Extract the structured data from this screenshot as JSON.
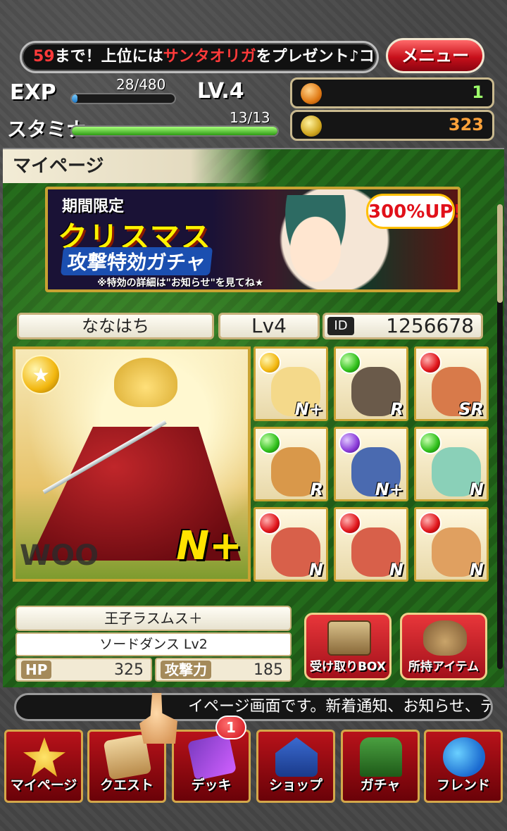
{
  "header": {
    "ticker_number": "59",
    "ticker_part1": "まで！上位には",
    "ticker_highlight": "サンタオリガ",
    "ticker_part2": "をプレゼント♪コ",
    "menu_label": "メニュー"
  },
  "stats": {
    "exp_label": "EXP",
    "exp_value": "28/480",
    "exp_fraction": 0.058,
    "level_label": "LV.4",
    "stamina_label": "スタミナ",
    "stamina_value": "13/13",
    "stamina_fraction": 1.0,
    "hearts": "1",
    "coins": "323"
  },
  "page": {
    "title": "マイページ"
  },
  "banner": {
    "line1": "期間限定",
    "line2": "クリスマス",
    "line3": "攻撃特効ガチャ",
    "note": "※特効の詳細は\"お知らせ\"を見てね★",
    "badge": "300%UP!"
  },
  "profile": {
    "name": "ななはち",
    "level": "Lv4",
    "id_label": "ID",
    "id_value": "1256678"
  },
  "leader": {
    "rank": "N+",
    "watermark": "WOO"
  },
  "deck": [
    {
      "orb": "yellow",
      "rank": "N+",
      "color": "#f4d98a"
    },
    {
      "orb": "green",
      "rank": "R",
      "color": "#6a5a4a"
    },
    {
      "orb": "red",
      "rank": "SR",
      "color": "#d87a4a"
    },
    {
      "orb": "green",
      "rank": "R",
      "color": "#d9984a"
    },
    {
      "orb": "purple",
      "rank": "N+",
      "color": "#4a6ab0"
    },
    {
      "orb": "green",
      "rank": "N",
      "color": "#8ad0b8"
    },
    {
      "orb": "red",
      "rank": "N",
      "color": "#d8604a"
    },
    {
      "orb": "red",
      "rank": "N",
      "color": "#d8604a"
    },
    {
      "orb": "red",
      "rank": "N",
      "color": "#e0a060"
    }
  ],
  "card_info": {
    "name": "王子ラスムス＋",
    "skill": "ソードダンス Lv2",
    "hp_label": "HP",
    "hp_value": "325",
    "atk_label": "攻撃力",
    "atk_value": "185"
  },
  "actions": {
    "box_label": "受け取りBOX",
    "items_label": "所持アイテム"
  },
  "info_ticker": "イページ画面です。新着通知、お知らせ、デ",
  "nav": {
    "mypage": "マイページ",
    "quest": "クエスト",
    "deck": "デッキ",
    "deck_badge": "1",
    "shop": "ショップ",
    "gacha": "ガチャ",
    "friend": "フレンド"
  }
}
